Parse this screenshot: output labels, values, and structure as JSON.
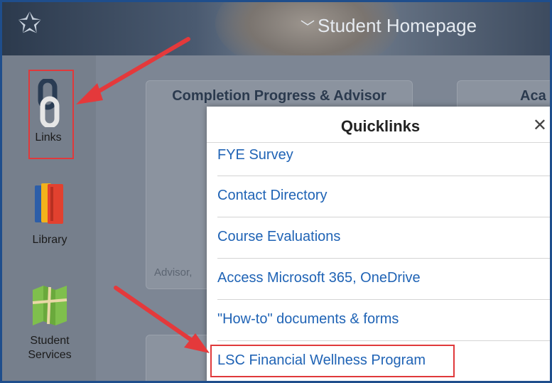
{
  "header": {
    "title": "Student Homepage"
  },
  "sidebar": {
    "items": [
      {
        "label": "Links",
        "icon": "chain-link-icon"
      },
      {
        "label": "Library",
        "icon": "books-icon"
      },
      {
        "label": "Student Services",
        "icon": "map-icon"
      }
    ]
  },
  "cards": {
    "completion_title": "Completion Progress & Advisor",
    "second_title": "Aca",
    "advisor_label": "Advisor,"
  },
  "modal": {
    "title": "Quicklinks",
    "close_glyph": "✕",
    "links": [
      "FYE Survey",
      "Contact Directory",
      "Course Evaluations",
      "Access Microsoft 365, OneDrive",
      "\"How-to\" documents & forms",
      "LSC Financial Wellness Program"
    ]
  },
  "colors": {
    "accent": "#1f63b5",
    "highlight": "#e0393b",
    "frame": "#1f4e8c"
  }
}
